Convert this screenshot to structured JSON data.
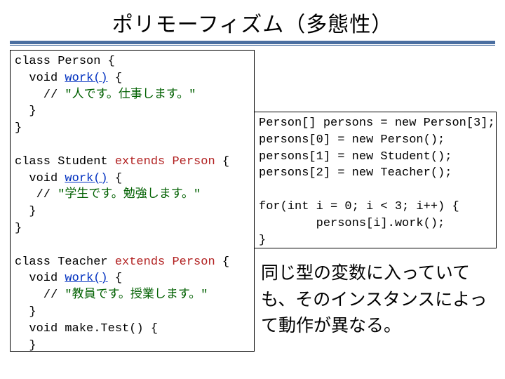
{
  "title": "ポリモーフィズム（多態性）",
  "left": {
    "l1": "class Person {",
    "l2": "  void ",
    "l2m": "work()",
    "l2e": " {",
    "l3": "    // ",
    "l3s": "\"人です。仕事します。\"",
    "l4": "  }",
    "l5": "}",
    "l6": "",
    "l7": "class Student ",
    "l7x": "extends Person",
    "l7e": " {",
    "l8": "  void ",
    "l8m": "work()",
    "l8e": " {",
    "l9": "   // ",
    "l9s": "\"学生です。勉強します。\"",
    "l10": "  }",
    "l11": "}",
    "l12": "",
    "l13": "class Teacher ",
    "l13x": "extends Person",
    "l13e": " {",
    "l14": "  void ",
    "l14m": "work()",
    "l14e": " {",
    "l15": "    // ",
    "l15s": "\"教員です。授業します。\"",
    "l16": "  }",
    "l17": "  void make.Test() {",
    "l18": "  }",
    "l19": "}"
  },
  "right": {
    "r1": "Person[] persons = new Person[3];",
    "r2": "persons[0] = new Person();",
    "r3": "persons[1] = new Student();",
    "r4": "persons[2] = new Teacher();",
    "r5": "",
    "r6": "for(int i = 0; i < 3; i++) {",
    "r7": "        persons[i].work();",
    "r8": "}"
  },
  "caption": "同じ型の変数に入っていても、そのインスタンスによって動作が異なる。"
}
